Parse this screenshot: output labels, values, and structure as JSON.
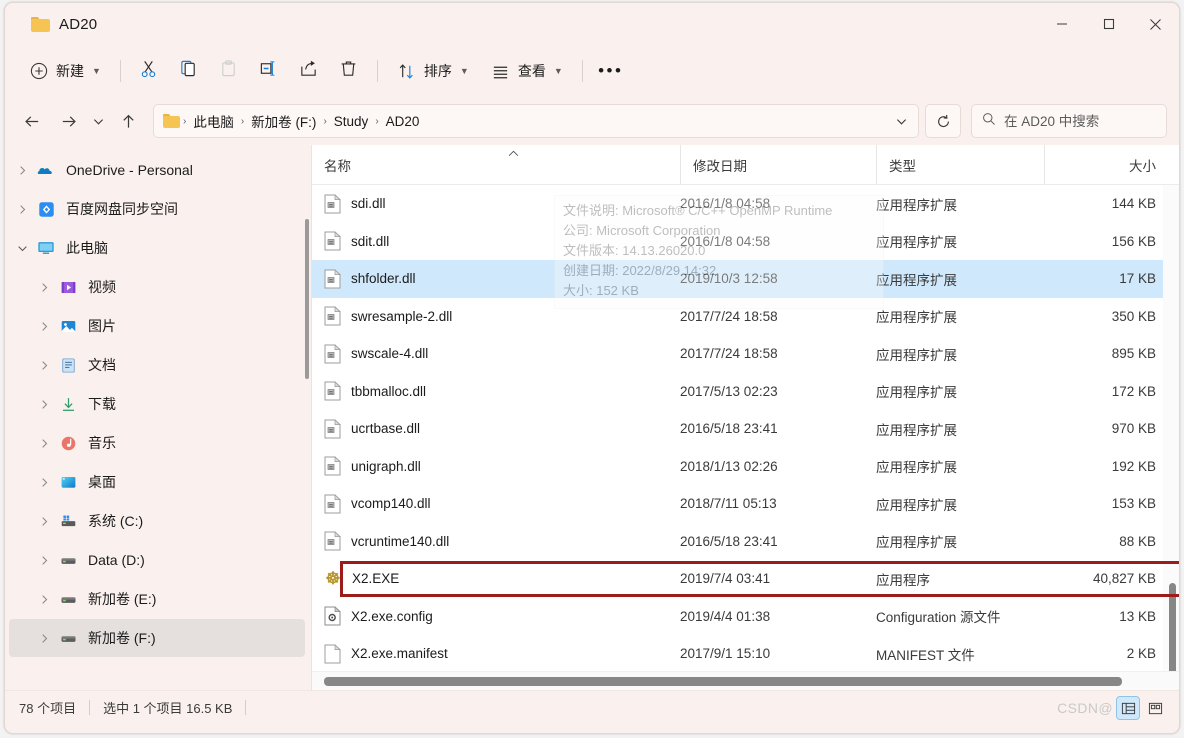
{
  "window": {
    "title": "AD20",
    "controls": {
      "minimize": "minimize-icon",
      "maximize": "maximize-icon",
      "close": "close-icon"
    }
  },
  "toolbar": {
    "new_label": "新建",
    "sort_label": "排序",
    "view_label": "查看",
    "more_label": "···",
    "icons": [
      "cut-icon",
      "copy-icon",
      "paste-icon",
      "rename-icon",
      "share-icon",
      "delete-icon"
    ]
  },
  "address": {
    "back": "back-icon",
    "forward": "forward-icon",
    "recent": "chevron-down-icon",
    "up": "up-icon",
    "refresh": "refresh-icon",
    "breadcrumb": [
      "此电脑",
      "新加卷 (F:)",
      "Study",
      "AD20"
    ]
  },
  "search": {
    "placeholder": "在 AD20 中搜索",
    "value": "",
    "icon": "search-icon"
  },
  "sidebar": {
    "items": [
      {
        "label": "OneDrive - Personal",
        "icon": "onedrive-icon",
        "indent": 1,
        "expanded": false,
        "selected": false
      },
      {
        "label": "百度网盘同步空间",
        "icon": "baidu-netdisk-icon",
        "indent": 1,
        "expanded": false,
        "selected": false
      },
      {
        "label": "此电脑",
        "icon": "this-pc-icon",
        "indent": 1,
        "expanded": true,
        "selected": false
      },
      {
        "label": "视频",
        "icon": "videos-icon",
        "indent": 2,
        "expanded": false,
        "selected": false
      },
      {
        "label": "图片",
        "icon": "pictures-icon",
        "indent": 2,
        "expanded": false,
        "selected": false
      },
      {
        "label": "文档",
        "icon": "documents-icon",
        "indent": 2,
        "expanded": false,
        "selected": false
      },
      {
        "label": "下载",
        "icon": "downloads-icon",
        "indent": 2,
        "expanded": false,
        "selected": false
      },
      {
        "label": "音乐",
        "icon": "music-icon",
        "indent": 2,
        "expanded": false,
        "selected": false
      },
      {
        "label": "桌面",
        "icon": "desktop-icon",
        "indent": 2,
        "expanded": false,
        "selected": false
      },
      {
        "label": "系统 (C:)",
        "icon": "system-drive-icon",
        "indent": 2,
        "expanded": false,
        "selected": false
      },
      {
        "label": "Data (D:)",
        "icon": "drive-icon",
        "indent": 2,
        "expanded": false,
        "selected": false
      },
      {
        "label": "新加卷 (E:)",
        "icon": "drive-icon",
        "indent": 2,
        "expanded": false,
        "selected": false
      },
      {
        "label": "新加卷 (F:)",
        "icon": "drive-icon",
        "indent": 2,
        "expanded": false,
        "selected": true
      }
    ]
  },
  "filelist": {
    "columns": [
      "名称",
      "修改日期",
      "类型",
      "大小"
    ],
    "sort_column": "名称",
    "sort_direction": "asc",
    "rows": [
      {
        "name": "sdi.dll",
        "date": "2016/1/8 04:58",
        "type": "应用程序扩展",
        "size": "144 KB",
        "icon": "dll-file-icon",
        "selected": false,
        "annotated": false
      },
      {
        "name": "sdit.dll",
        "date": "2016/1/8 04:58",
        "type": "应用程序扩展",
        "size": "156 KB",
        "icon": "dll-file-icon",
        "selected": false,
        "annotated": false
      },
      {
        "name": "shfolder.dll",
        "date": "2019/10/3 12:58",
        "type": "应用程序扩展",
        "size": "17 KB",
        "icon": "dll-file-icon",
        "selected": true,
        "annotated": false
      },
      {
        "name": "swresample-2.dll",
        "date": "2017/7/24 18:58",
        "type": "应用程序扩展",
        "size": "350 KB",
        "icon": "dll-file-icon",
        "selected": false,
        "annotated": false
      },
      {
        "name": "swscale-4.dll",
        "date": "2017/7/24 18:58",
        "type": "应用程序扩展",
        "size": "895 KB",
        "icon": "dll-file-icon",
        "selected": false,
        "annotated": false
      },
      {
        "name": "tbbmalloc.dll",
        "date": "2017/5/13 02:23",
        "type": "应用程序扩展",
        "size": "172 KB",
        "icon": "dll-file-icon",
        "selected": false,
        "annotated": false
      },
      {
        "name": "ucrtbase.dll",
        "date": "2016/5/18 23:41",
        "type": "应用程序扩展",
        "size": "970 KB",
        "icon": "dll-file-icon",
        "selected": false,
        "annotated": false
      },
      {
        "name": "unigraph.dll",
        "date": "2018/1/13 02:26",
        "type": "应用程序扩展",
        "size": "192 KB",
        "icon": "dll-file-icon",
        "selected": false,
        "annotated": false
      },
      {
        "name": "vcomp140.dll",
        "date": "2018/7/11 05:13",
        "type": "应用程序扩展",
        "size": "153 KB",
        "icon": "dll-file-icon",
        "selected": false,
        "annotated": false
      },
      {
        "name": "vcruntime140.dll",
        "date": "2016/5/18 23:41",
        "type": "应用程序扩展",
        "size": "88 KB",
        "icon": "dll-file-icon",
        "selected": false,
        "annotated": false
      },
      {
        "name": "X2.EXE",
        "date": "2019/7/4 03:41",
        "type": "应用程序",
        "size": "40,827 KB",
        "icon": "exe-file-icon",
        "selected": false,
        "annotated": true
      },
      {
        "name": "X2.exe.config",
        "date": "2019/4/4 01:38",
        "type": "Configuration 源文件",
        "size": "13 KB",
        "icon": "config-file-icon",
        "selected": false,
        "annotated": false
      },
      {
        "name": "X2.exe.manifest",
        "date": "2017/9/1 15:10",
        "type": "MANIFEST 文件",
        "size": "2 KB",
        "icon": "manifest-file-icon",
        "selected": false,
        "annotated": false
      }
    ]
  },
  "tooltip": {
    "lines": [
      "文件说明: Microsoft® C/C++ OpenMP Runtime",
      "公司: Microsoft Corporation",
      "文件版本: 14.13.26020.0",
      "创建日期: 2022/8/29 14:32",
      "大小: 152 KB"
    ]
  },
  "statusbar": {
    "item_count": "78 个项目",
    "selection": "选中 1 个项目  16.5 KB",
    "view_details": "details-view-icon",
    "view_large_icons": "large-icons-view-icon",
    "active_view": "details"
  },
  "watermark": {
    "text": "CSDN@"
  },
  "colors": {
    "accent": "#0078d4",
    "selection": "#cfe8fb",
    "annotation": "#9c1c1c",
    "chrome": "#faf1ee"
  }
}
